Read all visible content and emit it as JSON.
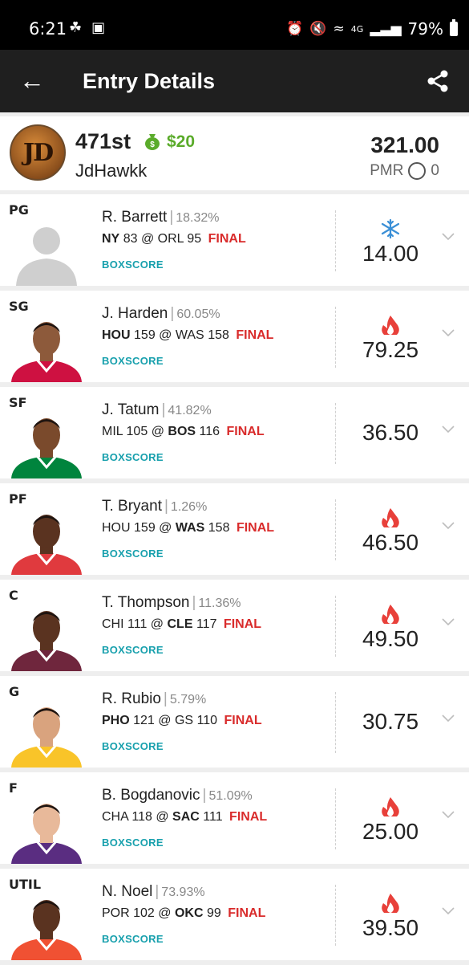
{
  "status_bar": {
    "time": "6:21",
    "battery": "79%",
    "network": "4G"
  },
  "app_bar": {
    "title": "Entry Details"
  },
  "summary": {
    "rank": "471st",
    "prize": "$20",
    "username": "JdHawkk",
    "total_points": "321.00",
    "pmr_label": "PMR",
    "pmr_value": "0",
    "avatar_text": "JD"
  },
  "colors": {
    "accent_green": "#5aab2a",
    "final_red": "#d92b2b",
    "boxscore_teal": "#18a0ad",
    "hot_red": "#e8403a",
    "cold_blue": "#3a8fd6"
  },
  "players": [
    {
      "pos": "PG",
      "name": "R. Barrett",
      "own": "18.32%",
      "team": "NY",
      "team_score": "83",
      "opp": "ORL",
      "opp_score": "95",
      "bold": "team",
      "status": "FINAL",
      "boxscore": "BOXSCORE",
      "points": "14.00",
      "trend": "cold",
      "photo": "placeholder",
      "jersey": "#cfcfcf",
      "skin": "#cfcfcf"
    },
    {
      "pos": "SG",
      "name": "J. Harden",
      "own": "60.05%",
      "team": "HOU",
      "team_score": "159",
      "opp": "WAS",
      "opp_score": "158",
      "bold": "team",
      "status": "FINAL",
      "boxscore": "BOXSCORE",
      "points": "79.25",
      "trend": "hot",
      "photo": "player",
      "jersey": "#ce1141",
      "skin": "#8d5a3b"
    },
    {
      "pos": "SF",
      "name": "J. Tatum",
      "own": "41.82%",
      "team": "MIL",
      "team_score": "105",
      "opp": "BOS",
      "opp_score": "116",
      "bold": "opp",
      "status": "FINAL",
      "boxscore": "BOXSCORE",
      "points": "36.50",
      "trend": "none",
      "photo": "player",
      "jersey": "#00843d",
      "skin": "#7a4a2c"
    },
    {
      "pos": "PF",
      "name": "T. Bryant",
      "own": "1.26%",
      "team": "HOU",
      "team_score": "159",
      "opp": "WAS",
      "opp_score": "158",
      "bold": "opp",
      "status": "FINAL",
      "boxscore": "BOXSCORE",
      "points": "46.50",
      "trend": "hot",
      "photo": "player",
      "jersey": "#e03a3e",
      "skin": "#5a3320"
    },
    {
      "pos": "C",
      "name": "T. Thompson",
      "own": "11.36%",
      "team": "CHI",
      "team_score": "111",
      "opp": "CLE",
      "opp_score": "117",
      "bold": "opp",
      "status": "FINAL",
      "boxscore": "BOXSCORE",
      "points": "49.50",
      "trend": "hot",
      "photo": "player",
      "jersey": "#6f263d",
      "skin": "#5a3320"
    },
    {
      "pos": "G",
      "name": "R. Rubio",
      "own": "5.79%",
      "team": "PHO",
      "team_score": "121",
      "opp": "GS",
      "opp_score": "110",
      "bold": "team",
      "status": "FINAL",
      "boxscore": "BOXSCORE",
      "points": "30.75",
      "trend": "none",
      "photo": "player",
      "jersey": "#f9c429",
      "skin": "#d9a37e"
    },
    {
      "pos": "F",
      "name": "B. Bogdanovic",
      "own": "51.09%",
      "team": "CHA",
      "team_score": "118",
      "opp": "SAC",
      "opp_score": "111",
      "bold": "opp",
      "status": "FINAL",
      "boxscore": "BOXSCORE",
      "points": "25.00",
      "trend": "hot",
      "photo": "player",
      "jersey": "#5a2d81",
      "skin": "#e8b99a"
    },
    {
      "pos": "UTIL",
      "name": "N. Noel",
      "own": "73.93%",
      "team": "POR",
      "team_score": "102",
      "opp": "OKC",
      "opp_score": "99",
      "bold": "opp",
      "status": "FINAL",
      "boxscore": "BOXSCORE",
      "points": "39.50",
      "trend": "hot",
      "photo": "player",
      "jersey": "#f05133",
      "skin": "#5a3320"
    }
  ]
}
